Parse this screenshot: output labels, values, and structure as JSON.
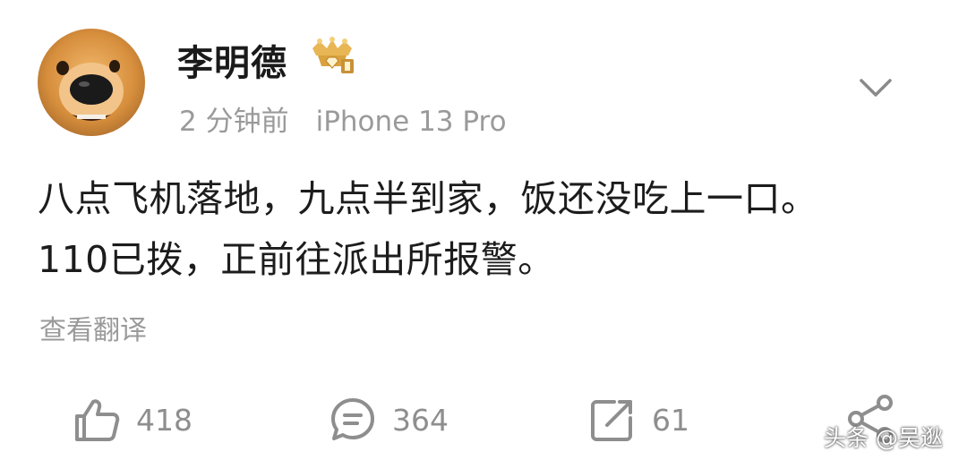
{
  "user": {
    "name": "李明德"
  },
  "meta": {
    "time": "2 分钟前",
    "device": "iPhone 13 Pro"
  },
  "post": {
    "lines": [
      "八点飞机落地，九点半到家，饭还没吃上一口。",
      "110已拨，正前往派出所报警。"
    ],
    "translate_label": "查看翻译"
  },
  "actions": {
    "likes": "418",
    "comments": "364",
    "reposts": "61"
  },
  "watermark": "头条 @吴逖",
  "colors": {
    "text": "#1c1c1c",
    "secondary": "#9a9a9a",
    "icon": "#8e8e8e"
  },
  "icons": [
    "thumbs-up-icon",
    "comment-icon",
    "repost-icon",
    "share-icon",
    "chevron-down-icon",
    "vip-crown-badge"
  ]
}
